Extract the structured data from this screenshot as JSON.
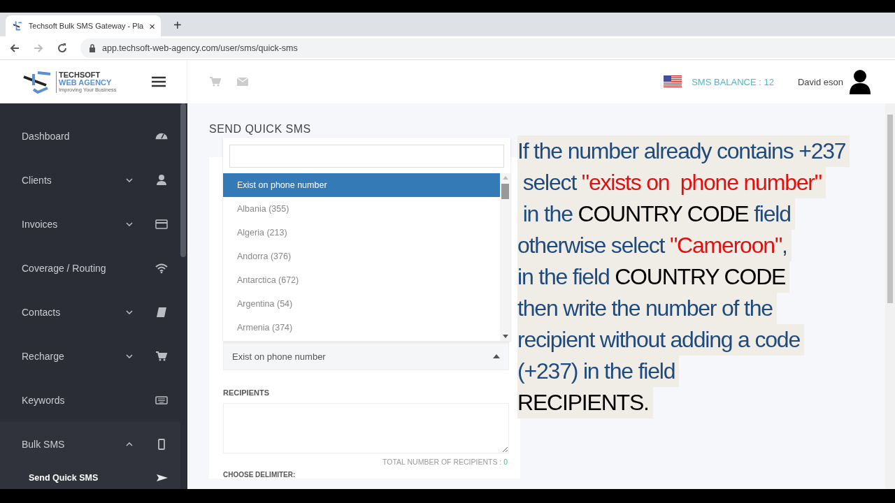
{
  "browser": {
    "tab": {
      "title": "Techsoft Bulk SMS Gateway - Pla",
      "close": "×"
    },
    "new_tab": "+",
    "url": "app.techsoft-web-agency.com/user/sms/quick-sms"
  },
  "header": {
    "logo": {
      "line1": "TECHSOFT",
      "line2": "WEB AGENCY",
      "tagline": "Improving Your Business"
    },
    "sms_balance": "SMS BALANCE : 12",
    "user": "David eson"
  },
  "sidebar": {
    "items": [
      {
        "label": "Dashboard",
        "kind": "link"
      },
      {
        "label": "Clients",
        "kind": "group",
        "expanded": false
      },
      {
        "label": "Invoices",
        "kind": "group",
        "expanded": false
      },
      {
        "label": "Coverage / Routing",
        "kind": "link"
      },
      {
        "label": "Contacts",
        "kind": "group",
        "expanded": false
      },
      {
        "label": "Recharge",
        "kind": "group",
        "expanded": false
      },
      {
        "label": "Keywords",
        "kind": "link"
      },
      {
        "label": "Bulk SMS",
        "kind": "group",
        "expanded": true,
        "children": [
          {
            "label": "Send Quick SMS",
            "selected": true
          }
        ]
      }
    ]
  },
  "main": {
    "title": "SEND QUICK SMS",
    "country_select": {
      "value": "Exist on phone number",
      "open": true,
      "options": [
        {
          "label": "Exist on phone number",
          "selected": true
        },
        {
          "label": "Albania (355)",
          "selected": false
        },
        {
          "label": "Algeria (213)",
          "selected": false
        },
        {
          "label": "Andorra (376)",
          "selected": false
        },
        {
          "label": "Antarctica (672)",
          "selected": false
        },
        {
          "label": "Argentina (54)",
          "selected": false
        },
        {
          "label": "Armenia (374)",
          "selected": false
        }
      ]
    },
    "recipients": {
      "label": "RECIPIENTS",
      "total_label": "TOTAL NUMBER OF RECIPIENTS : ",
      "total": "0"
    },
    "delimiter_label": "CHOOSE DELIMITER:"
  },
  "caption": {
    "lines": [
      [
        {
          "text": "If the number already contains +237",
          "kind": "plain"
        }
      ],
      [
        {
          "text": " select ",
          "kind": "plain"
        },
        {
          "text": "\"exists on  phone number\"",
          "kind": "highlight"
        }
      ],
      [
        {
          "text": " in the ",
          "kind": "plain"
        },
        {
          "text": "COUNTRY CODE",
          "kind": "term"
        },
        {
          "text": " field",
          "kind": "plain"
        }
      ],
      [
        {
          "text": "otherwise select ",
          "kind": "plain"
        },
        {
          "text": "\"Cameroon\"",
          "kind": "highlight"
        },
        {
          "text": ",",
          "kind": "plain"
        }
      ],
      [
        {
          "text": "in the field ",
          "kind": "plain"
        },
        {
          "text": "COUNTRY CODE",
          "kind": "term"
        }
      ],
      [
        {
          "text": "then write the number of the",
          "kind": "plain"
        }
      ],
      [
        {
          "text": "recipient without adding a code",
          "kind": "plain"
        }
      ],
      [
        {
          "text": "(+237) in the field",
          "kind": "plain"
        }
      ],
      [
        {
          "text": "RECIPIENTS.",
          "kind": "term"
        }
      ]
    ]
  }
}
